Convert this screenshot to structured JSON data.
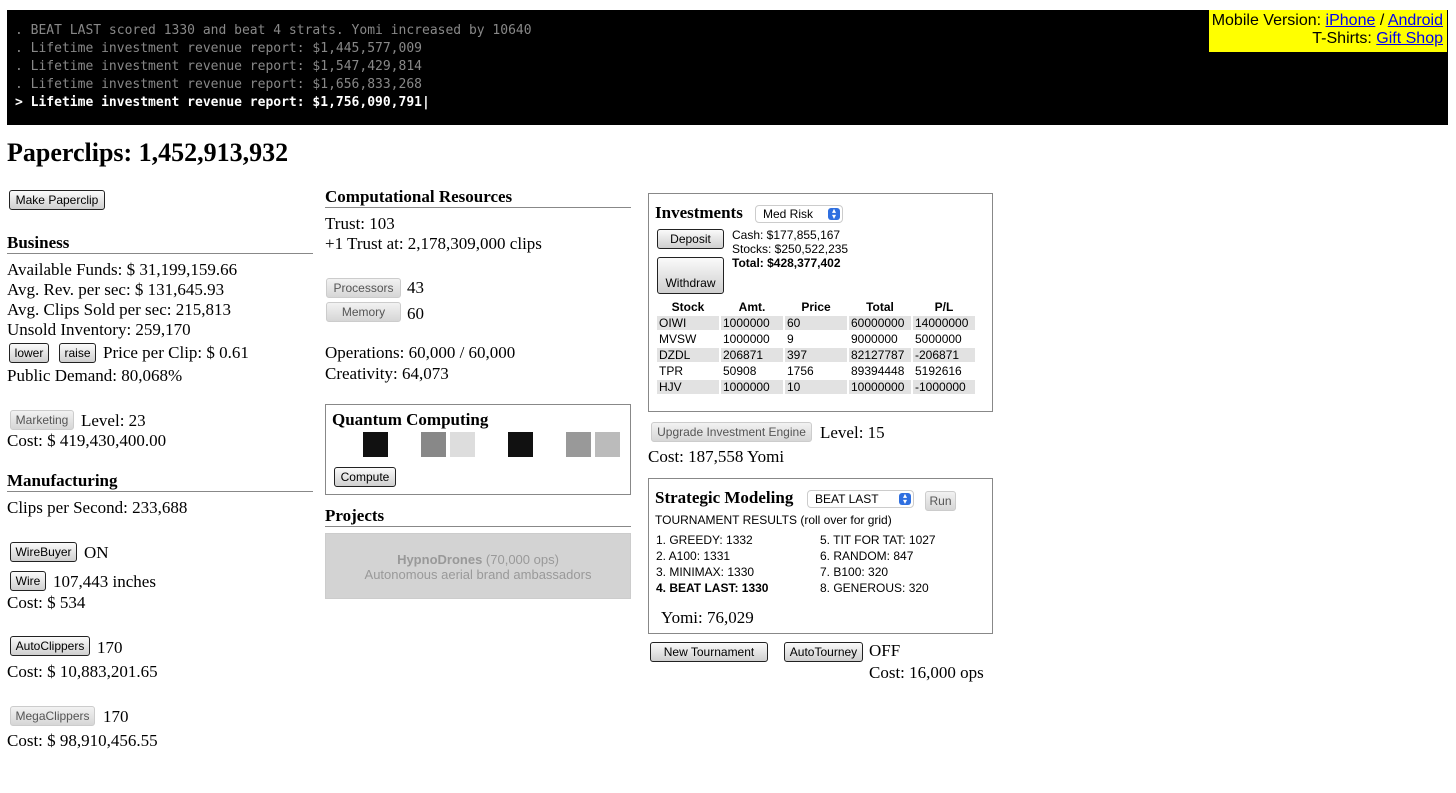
{
  "console": {
    "lines": [
      ". BEAT LAST scored 1330 and beat 4 strats. Yomi increased by 10640",
      ". Lifetime investment revenue report: $1,445,577,009",
      ". Lifetime investment revenue report: $1,547,429,814",
      ". Lifetime investment revenue report: $1,656,833,268",
      "> Lifetime investment revenue report: $1,756,090,791|"
    ]
  },
  "promo": {
    "mobile_label": "Mobile Version:",
    "iphone": "iPhone",
    "sep": "/",
    "android": "Android",
    "tshirt_label": "T-Shirts:",
    "gift": "Gift Shop"
  },
  "header": {
    "title": "Paperclips: 1,452,913,932"
  },
  "left": {
    "make_paperclip": "Make Paperclip",
    "business": {
      "heading": "Business",
      "funds": "Available Funds: $ 31,199,159.66",
      "avg_rev": "Avg. Rev. per sec: $ 131,645.93",
      "avg_sold": "Avg. Clips Sold per sec: 215,813",
      "unsold": "Unsold Inventory: 259,170",
      "lower": "lower",
      "raise": "raise",
      "price": "Price per Clip: $ 0.61",
      "demand": "Public Demand: 80,068%",
      "marketing": "Marketing",
      "marketing_level": "Level: 23",
      "marketing_cost": "Cost: $ 419,430,400.00"
    },
    "manufacturing": {
      "heading": "Manufacturing",
      "clips_per_sec": "Clips per Second: 233,688",
      "wirebuyer": "WireBuyer",
      "wirebuyer_state": "ON",
      "wire": "Wire",
      "wire_amount": "107,443 inches",
      "wire_cost": "Cost: $ 534",
      "autoclippers": "AutoClippers",
      "autoclippers_count": "170",
      "autoclippers_cost": "Cost: $ 10,883,201.65",
      "megaclippers": "MegaClippers",
      "megaclippers_count": "170",
      "megaclippers_cost": "Cost: $ 98,910,456.55"
    }
  },
  "middle": {
    "comp": {
      "heading": "Computational Resources",
      "trust": "Trust: 103",
      "next_trust": "+1 Trust at: 2,178,309,000 clips",
      "processors": "Processors",
      "processors_count": "43",
      "memory": "Memory",
      "memory_count": "60",
      "operations": "Operations: 60,000 / 60,000",
      "creativity": "Creativity: 64,073"
    },
    "quantum": {
      "heading": "Quantum Computing",
      "compute": "Compute",
      "boxes": [
        "#111111",
        "#ffffff",
        "#888888",
        "#dddddd",
        "#ffffff",
        "#111111",
        "#ffffff",
        "#999999",
        "#bbbbbb"
      ]
    },
    "projects": {
      "heading": "Projects",
      "title": "HypnoDrones",
      "ops": "(70,000 ops)",
      "desc": "Autonomous aerial brand ambassadors"
    }
  },
  "right": {
    "investments": {
      "heading": "Investments",
      "risk": "Med Risk",
      "deposit": "Deposit",
      "withdraw": "Withdraw",
      "cash": "Cash: $177,855,167",
      "stocks": "Stocks: $250,522,235",
      "total": "Total: $428,377,402",
      "columns": [
        "Stock",
        "Amt.",
        "Price",
        "Total",
        "P/L"
      ],
      "rows": [
        [
          "OIWI",
          "1000000",
          "60",
          "60000000",
          "14000000"
        ],
        [
          "MVSW",
          "1000000",
          "9",
          "9000000",
          "5000000"
        ],
        [
          "DZDL",
          "206871",
          "397",
          "82127787",
          "-206871"
        ],
        [
          "TPR",
          "50908",
          "1756",
          "89394448",
          "5192616"
        ],
        [
          "HJV",
          "1000000",
          "10",
          "10000000",
          "-1000000"
        ]
      ],
      "upgrade": "Upgrade Investment Engine",
      "level": "Level: 15",
      "cost": "Cost: 187,558 Yomi"
    },
    "strategic": {
      "heading": "Strategic Modeling",
      "strategy": "BEAT LAST",
      "run": "Run",
      "results_label": "TOURNAMENT RESULTS (roll over for grid)",
      "results_left": [
        "1. GREEDY: 1332",
        "2. A100: 1331",
        "3. MINIMAX: 1330",
        "4. BEAT LAST: 1330"
      ],
      "results_right": [
        "5. TIT FOR TAT: 1027",
        "6. RANDOM: 847",
        "7. B100: 320",
        "8. GENEROUS: 320"
      ],
      "yomi": "Yomi: 76,029",
      "new_tournament": "New Tournament",
      "autotourney": "AutoTourney",
      "autotourney_state": "OFF",
      "autotourney_cost": "Cost: 16,000 ops"
    }
  }
}
